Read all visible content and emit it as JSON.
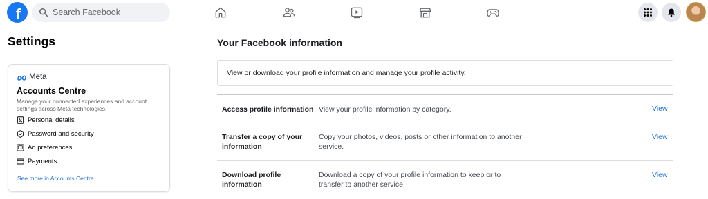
{
  "topbar": {
    "logo_letter": "f",
    "search_placeholder": "Search Facebook",
    "nav_icons": [
      "home-icon",
      "friends-icon",
      "watch-icon",
      "marketplace-icon",
      "gaming-icon"
    ],
    "right_icons": [
      "menu-grid-icon",
      "notifications-icon",
      "profile-avatar"
    ]
  },
  "sidebar": {
    "title": "Settings",
    "accounts_centre": {
      "brand": "Meta",
      "title": "Accounts Centre",
      "description": "Manage your connected experiences and account settings across Meta technologies.",
      "items": [
        {
          "label": "Personal details",
          "icon": "id-card-icon"
        },
        {
          "label": "Password and security",
          "icon": "shield-icon"
        },
        {
          "label": "Ad preferences",
          "icon": "ad-icon"
        },
        {
          "label": "Payments",
          "icon": "credit-card-icon"
        }
      ],
      "link": "See more in Accounts Centre"
    }
  },
  "main": {
    "title": "Your Facebook information",
    "intro": "View or download your profile information and manage your profile activity.",
    "rows": [
      {
        "label": "Access profile information",
        "description": "View your profile information by category.",
        "action": "View"
      },
      {
        "label": "Transfer a copy of your information",
        "description": "Copy your photos, videos, posts or other information to another service.",
        "action": "View"
      },
      {
        "label": "Download profile information",
        "description": "Download a copy of your profile information to keep or to transfer to another service.",
        "action": "View"
      }
    ]
  },
  "colors": {
    "brand_blue": "#1877f2",
    "link_blue": "#216fdb",
    "secondary_text": "#65676b"
  }
}
